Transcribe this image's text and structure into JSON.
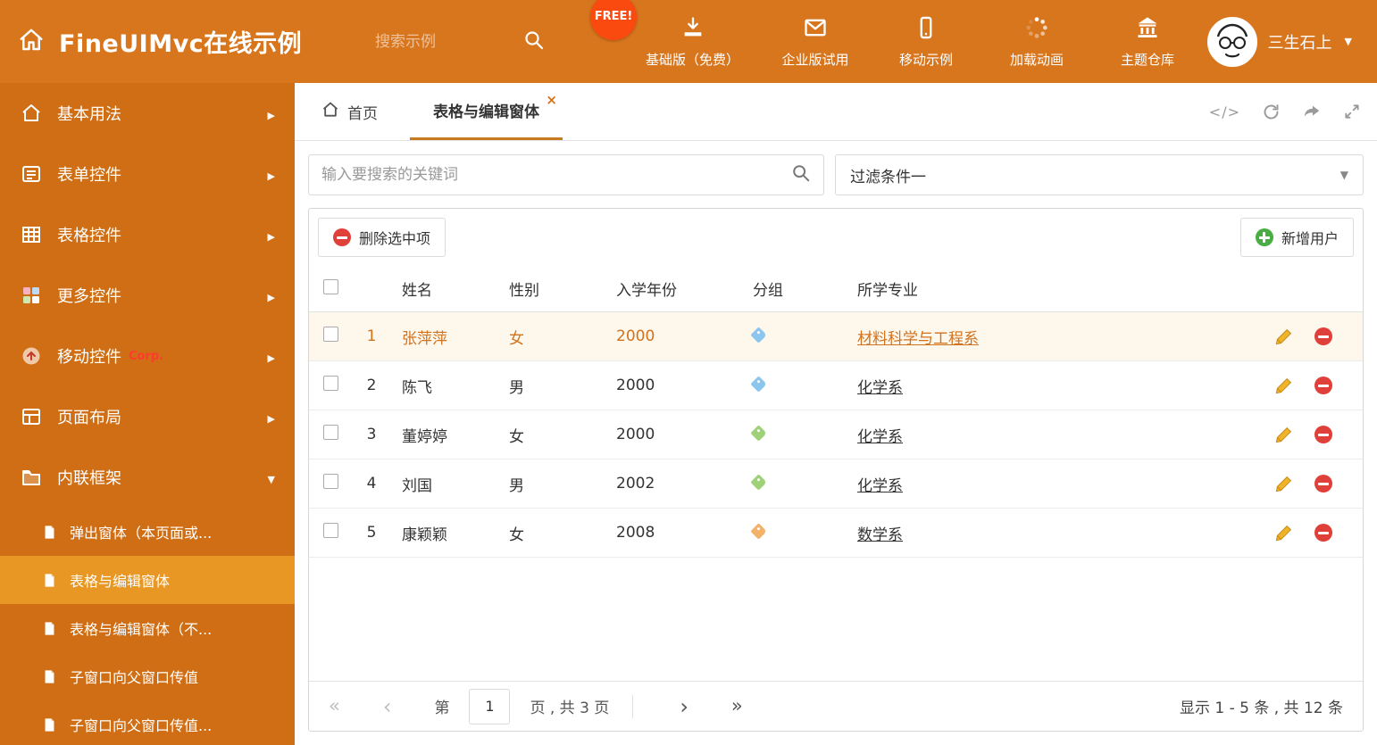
{
  "colors": {
    "header_bg": "#d8761e",
    "sidebar_bg": "#cf6e14",
    "sidebar_active_bg": "#e89724",
    "tab_accent": "#c87a1f",
    "free_badge_bg": "#fb4a10",
    "delete_red": "#e0403a",
    "add_green": "#49ad43",
    "row_highlight_bg": "#fdf7ec",
    "link_orange": "#d2721c",
    "tag_blue": "#8cc6ee",
    "tag_green": "#9fd178",
    "tag_orange": "#f2b26a"
  },
  "header": {
    "title": "FineUIMvc在线示例",
    "search_placeholder": "搜索示例",
    "free_badge": "FREE!",
    "nav": [
      {
        "label": "基础版（免费）",
        "icon": "download-icon"
      },
      {
        "label": "企业版试用",
        "icon": "envelope-icon"
      },
      {
        "label": "移动示例",
        "icon": "mobile-icon"
      },
      {
        "label": "加载动画",
        "icon": "spinner-icon"
      },
      {
        "label": "主题仓库",
        "icon": "bank-icon"
      }
    ],
    "user_name": "三生石上"
  },
  "sidebar": {
    "items": [
      {
        "label": "基本用法",
        "icon": "home-icon"
      },
      {
        "label": "表单控件",
        "icon": "form-icon"
      },
      {
        "label": "表格控件",
        "icon": "table-icon"
      },
      {
        "label": "更多控件",
        "icon": "widgets-icon"
      },
      {
        "label": "移动控件",
        "badge": "Corp.",
        "icon": "mobile-icon"
      },
      {
        "label": "页面布局",
        "icon": "layout-icon"
      },
      {
        "label": "内联框架",
        "icon": "frame-icon"
      }
    ],
    "subitems": [
      {
        "label": "弹出窗体（本页面或..."
      },
      {
        "label": "表格与编辑窗体"
      },
      {
        "label": "表格与编辑窗体（不..."
      },
      {
        "label": "子窗口向父窗口传值"
      },
      {
        "label": "子窗口向父窗口传值..."
      }
    ]
  },
  "tabs": {
    "home": "首页",
    "active": "表格与编辑窗体"
  },
  "filters": {
    "search_placeholder": "输入要搜索的关键词",
    "filter_selected": "过滤条件一"
  },
  "grid": {
    "delete_button": "删除选中项",
    "add_button": "新增用户",
    "columns": {
      "name": "姓名",
      "gender": "性别",
      "year": "入学年份",
      "group": "分组",
      "major": "所学专业"
    },
    "rows": [
      {
        "num": "1",
        "name": "张萍萍",
        "gender": "女",
        "year": "2000",
        "tag": "blue",
        "major": "材料科学与工程系"
      },
      {
        "num": "2",
        "name": "陈飞",
        "gender": "男",
        "year": "2000",
        "tag": "blue",
        "major": "化学系"
      },
      {
        "num": "3",
        "name": "董婷婷",
        "gender": "女",
        "year": "2000",
        "tag": "green",
        "major": "化学系"
      },
      {
        "num": "4",
        "name": "刘国",
        "gender": "男",
        "year": "2002",
        "tag": "green",
        "major": "化学系"
      },
      {
        "num": "5",
        "name": "康颖颖",
        "gender": "女",
        "year": "2008",
        "tag": "orange",
        "major": "数学系"
      }
    ]
  },
  "pagination": {
    "page_label_prefix": "第",
    "page_value": "1",
    "page_label_suffix": "页 , 共 3 页",
    "summary": "显示 1 - 5 条 , 共 12 条"
  }
}
